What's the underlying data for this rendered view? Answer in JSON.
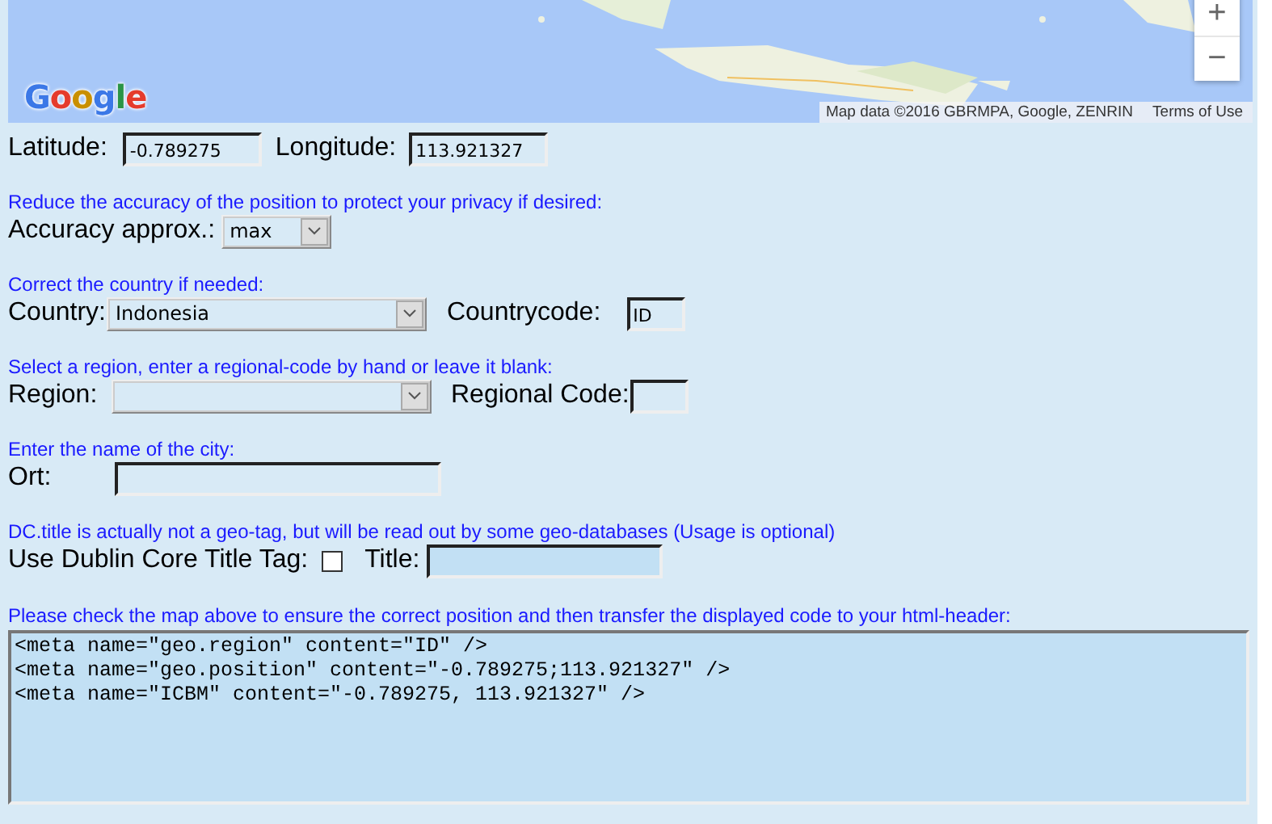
{
  "map": {
    "logo": "Google",
    "attribution": "Map data ©2016 GBRMPA, Google, ZENRIN",
    "terms": "Terms of Use",
    "zoom_in": "+",
    "zoom_out": "−"
  },
  "sections": [
    {
      "items": [
        {
          "kind": "input",
          "label": "Latitude:",
          "value": "-0.789275"
        },
        {
          "kind": "input",
          "label": "Longitude:",
          "value": "113.921327"
        }
      ]
    },
    {
      "hint": "Reduce the accuracy of the position to protect your privacy if desired:",
      "items": [
        {
          "kind": "select",
          "label": "Accuracy approx.:",
          "value": "max"
        }
      ]
    },
    {
      "hint": "Correct the country if needed:",
      "items": [
        {
          "kind": "select",
          "label": "Country:",
          "value": "Indonesia"
        },
        {
          "kind": "input",
          "label": "Countrycode:",
          "value": "ID"
        }
      ]
    },
    {
      "hint": "Select a region, enter a regional-code by hand or leave it blank:",
      "items": [
        {
          "kind": "select",
          "label": "Region:",
          "value": null
        },
        {
          "kind": "input",
          "label": "Regional Code:",
          "value": null
        }
      ]
    },
    {
      "hint": "Enter the name of the city:",
      "items": [
        {
          "kind": "input",
          "label": "Ort:",
          "value": null
        }
      ]
    },
    {
      "hint": "DC.title is actually not a geo-tag, but will be read out by some geo-databases (Usage is optional)",
      "items": [
        {
          "kind": "checkbox",
          "label": "Use Dublin Core Title Tag:",
          "checked": false
        },
        {
          "kind": "input",
          "label": "Title:",
          "value": null
        }
      ]
    }
  ],
  "code": {
    "hint": "Please check the map above to ensure the correct position and then transfer the displayed code to your html-header:",
    "lines": [
      "<meta name=\"geo.region\" content=\"ID\" />",
      "<meta name=\"geo.position\" content=\"-0.789275;113.921327\" />",
      "<meta name=\"ICBM\" content=\"-0.789275, 113.921327\" />"
    ]
  }
}
